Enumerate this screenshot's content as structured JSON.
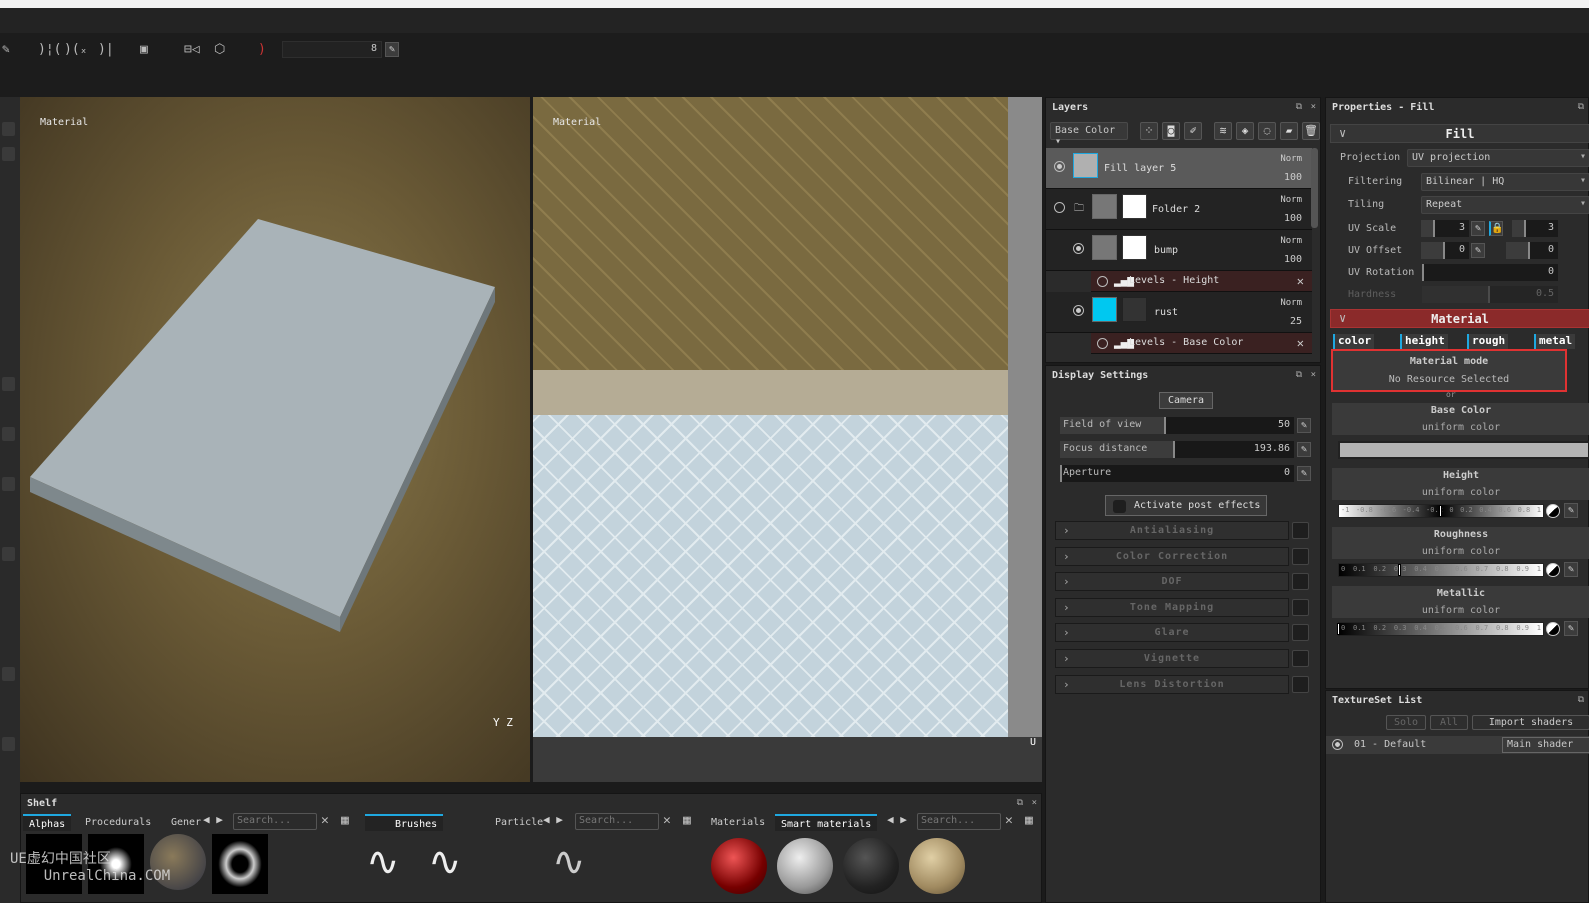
{
  "toolbar": {
    "brush_size": "8",
    "icons": [
      "brush-icon",
      "symmetry-icon",
      "mirror-x-icon",
      "mirror-icon",
      "view-mode-icon",
      "camera-icon",
      "cube-icon",
      "lazy-mouse-icon"
    ]
  },
  "viewport3d": {
    "label": "Material",
    "axes": "Y Z"
  },
  "viewport2d": {
    "label": "Material",
    "axes": "U"
  },
  "layers": {
    "title": "Layers",
    "channel": "Base Color",
    "items": [
      {
        "name": "Fill layer 5",
        "blend": "Norm",
        "opacity": "100",
        "selected": true
      },
      {
        "name": "Folder 2",
        "blend": "Norm",
        "opacity": "100"
      },
      {
        "name": "bump",
        "blend": "Norm",
        "opacity": "100"
      },
      {
        "name": "rust",
        "blend": "Norm",
        "opacity": "25"
      }
    ],
    "effects": [
      "Levels - Height",
      "Levels - Base Color"
    ]
  },
  "display": {
    "title": "Display Settings",
    "camera": "Camera",
    "fov_label": "Field of view",
    "fov": "50",
    "focus_label": "Focus distance",
    "focus": "193.86",
    "aperture_label": "Aperture",
    "aperture": "0",
    "post_label": "Activate post effects",
    "sections": [
      "Antialiasing",
      "Color Correction",
      "DOF",
      "Tone Mapping",
      "Glare",
      "Vignette",
      "Lens Distortion"
    ]
  },
  "properties": {
    "title": "Properties - Fill",
    "fill_header": "Fill",
    "projection_label": "Projection",
    "projection": "UV projection",
    "filtering_label": "Filtering",
    "filtering": "Bilinear | HQ",
    "tiling_label": "Tiling",
    "tiling": "Repeat",
    "uvscale_label": "UV Scale",
    "uvscale_u": "3",
    "uvscale_v": "3",
    "uvoffset_label": "UV Offset",
    "uvoffset_u": "0",
    "uvoffset_v": "0",
    "uvrot_label": "UV Rotation",
    "uvrot": "0",
    "hardness_label": "Hardness",
    "hardness": "0.5",
    "material_header": "Material",
    "channel_tabs": [
      "color",
      "height",
      "rough",
      "metal"
    ],
    "mat_mode": "Material mode",
    "mat_mode_value": "No Resource Selected",
    "or": "or",
    "channels": [
      {
        "name": "Base Color",
        "mode": "uniform color",
        "color": "#b4b4b4"
      },
      {
        "name": "Height",
        "mode": "uniform color",
        "ticks": [
          "-1",
          "-0.8",
          "-0.6",
          "-0.4",
          "-0.2",
          "0",
          "0.2",
          "0.4",
          "0.6",
          "0.8",
          "1"
        ],
        "value": 0
      },
      {
        "name": "Roughness",
        "mode": "uniform color",
        "ticks": [
          "0",
          "0.1",
          "0.2",
          "0.3",
          "0.4",
          "0.5",
          "0.6",
          "0.7",
          "0.8",
          "0.9",
          "1"
        ],
        "value": 0.3
      },
      {
        "name": "Metallic",
        "mode": "uniform color",
        "ticks": [
          "0",
          "0.1",
          "0.2",
          "0.3",
          "0.4",
          "0.5",
          "0.6",
          "0.7",
          "0.8",
          "0.9",
          "1"
        ],
        "value": 0
      }
    ]
  },
  "textureset": {
    "title": "TextureSet List",
    "solo": "Solo",
    "all": "All",
    "import": "Import shaders",
    "item": "01 - Default",
    "shader": "Main shader"
  },
  "shelf": {
    "title": "Shelf",
    "tabs1": [
      "Alphas",
      "Procedurals",
      "Gener"
    ],
    "tabs2": [
      "Brushes",
      "Particle"
    ],
    "tabs3": [
      "Materials",
      "Smart materials"
    ],
    "search_placeholder": "Search..."
  },
  "watermark": "UE虚幻中国社区 UnrealChina.COM",
  "colors": {
    "accent": "#1fa8e0",
    "material_header": "#8b2a2a",
    "highlight": "#e03232"
  }
}
